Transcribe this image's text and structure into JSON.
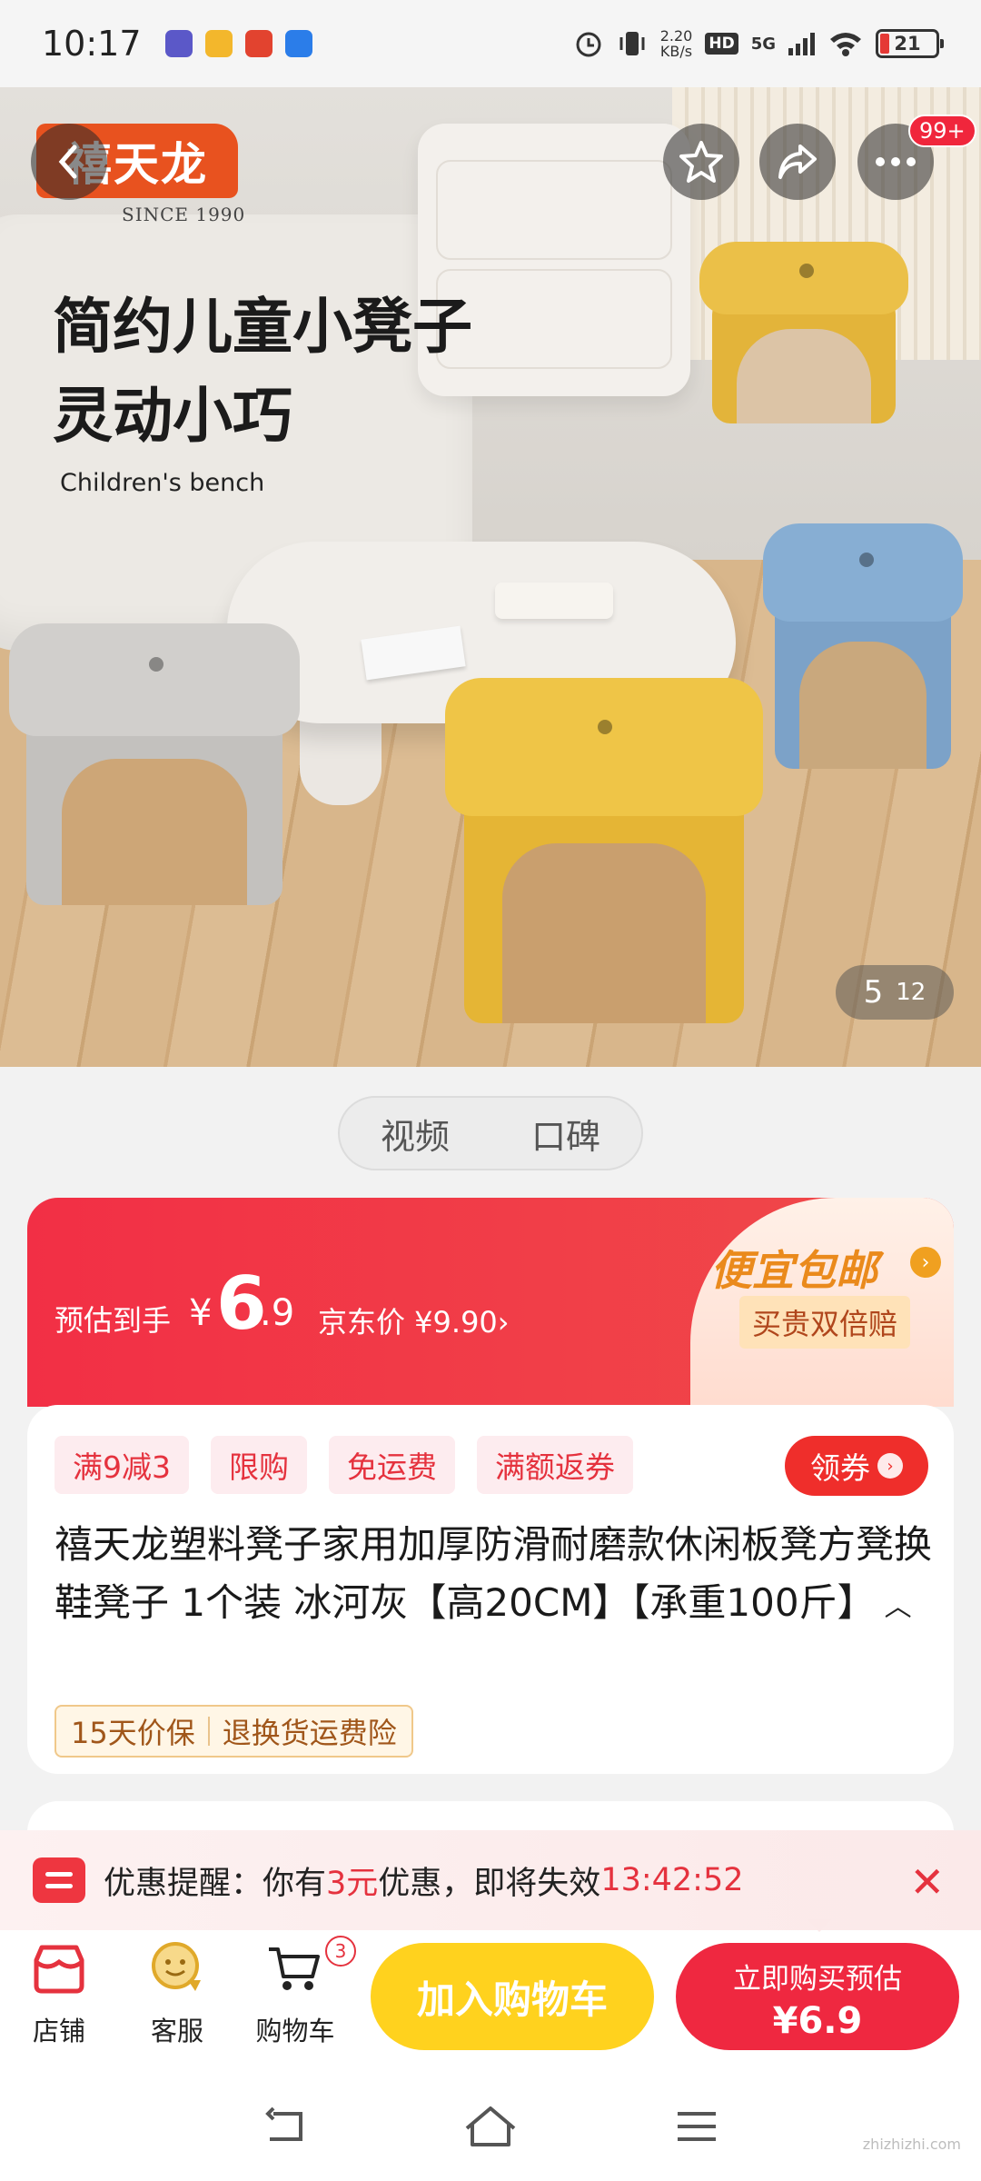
{
  "status_bar": {
    "time": "10:17",
    "net_speed_value": "2.20",
    "net_speed_unit": "KB/s",
    "hd": "HD",
    "network": "5G",
    "battery": "21",
    "icons": [
      "notification-app-icon",
      "alarm-icon",
      "vibrate-icon",
      "signal-icon",
      "wifi-icon",
      "battery-icon"
    ]
  },
  "hero": {
    "brand": "禧天龙",
    "brand_since": "SINCE 1990",
    "headline_line1": "简约儿童小凳子",
    "headline_line2": "灵动小巧",
    "subheadline": "Children's bench",
    "more_badge": "99+",
    "pager_current": "5",
    "pager_total": "12",
    "stool_colors": {
      "yellow": "#e9bd3e",
      "blue": "#7fa6cc",
      "gray": "#c9c7c4"
    }
  },
  "media_tabs": [
    "视频",
    "口碑"
  ],
  "price": {
    "label": "预估到手",
    "currency": "¥",
    "int": "6",
    "dec": ".9",
    "jd_price": "京东价 ¥9.90›",
    "promo": "便宜包邮",
    "guarantee": "买贵双倍赔"
  },
  "info": {
    "tags": [
      "满9减3",
      "限购",
      "免运费",
      "满额返券"
    ],
    "coupon": "领券",
    "title": "禧天龙塑料凳子家用加厚防滑耐磨款休闲板凳方凳换鞋凳子 1个装 冰河灰【高20CM】【承重100斤】",
    "services": [
      "15天价保",
      "退换货运费险"
    ]
  },
  "reminder": {
    "prefix": "优惠提醒：你有",
    "amount": "3元",
    "middle": "优惠，即将失效",
    "countdown": "13:42:52"
  },
  "actions": {
    "store": "店铺",
    "service": "客服",
    "cart": "购物车",
    "cart_count": "3",
    "add_to_cart": "加入购物车",
    "buy_now_line1": "立即购买预估",
    "buy_now_line2": "¥6.9"
  },
  "colors": {
    "accent_red": "#ef2840",
    "accent_yellow": "#ffd21e",
    "promo_orange": "#ea8a1c"
  },
  "watermark": "zhizhizhi.com"
}
